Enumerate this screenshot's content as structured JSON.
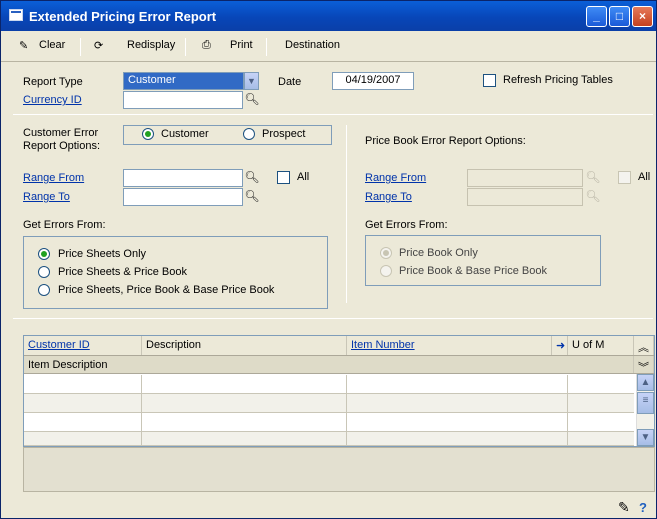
{
  "window": {
    "title": "Extended Pricing Error Report"
  },
  "toolbar": {
    "clear": "Clear",
    "redisplay": "Redisplay",
    "print": "Print",
    "destination": "Destination"
  },
  "form": {
    "report_type_label": "Report Type",
    "report_type_value": "Customer",
    "date_label": "Date",
    "date_value": "04/19/2007",
    "refresh_label": "Refresh Pricing Tables",
    "currency_label": "Currency ID",
    "currency_value": ""
  },
  "customer": {
    "options_label_1": "Customer Error",
    "options_label_2": "Report Options:",
    "radio_customer": "Customer",
    "radio_prospect": "Prospect",
    "range_from": "Range From",
    "range_to": "Range To",
    "all": "All",
    "get_errors_from": "Get Errors From:",
    "opt1": "Price Sheets Only",
    "opt2": "Price Sheets & Price Book",
    "opt3": "Price Sheets, Price Book & Base Price Book"
  },
  "pricebook": {
    "header": "Price Book Error Report Options:",
    "range_from": "Range From",
    "range_to": "Range To",
    "all": "All",
    "get_errors_from": "Get Errors From:",
    "opt1": "Price Book Only",
    "opt2": "Price Book & Base Price Book"
  },
  "grid": {
    "col_customer": "Customer ID",
    "col_description": "Description",
    "col_item_number": "Item Number",
    "col_uofm": "U of M",
    "row2": "Item Description"
  },
  "icons": [
    "clear-icon",
    "redisplay-icon",
    "print-icon",
    "lookup-icon",
    "help-icon",
    "note-icon"
  ]
}
